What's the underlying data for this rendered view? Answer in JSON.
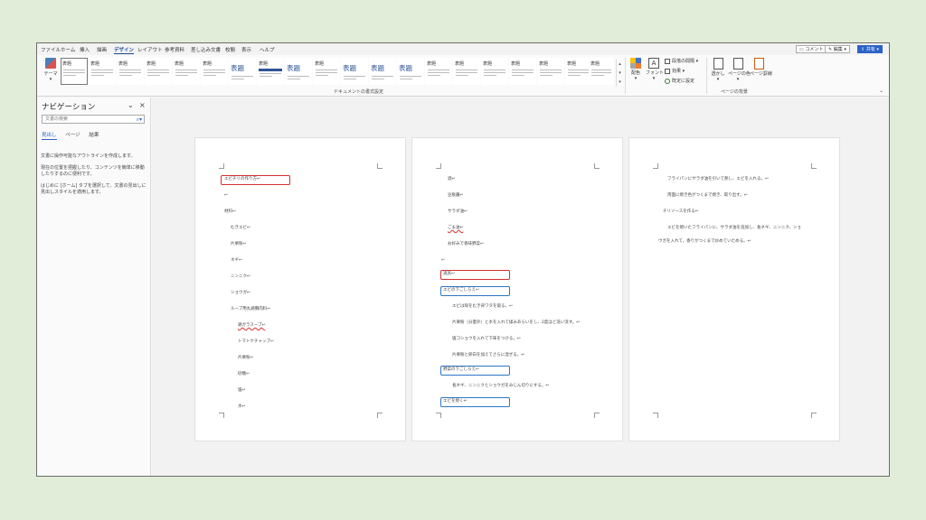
{
  "menu": {
    "tabs": [
      "ファイル",
      "ホーム",
      "挿入",
      "描画",
      "デザイン",
      "レイアウト",
      "参考資料",
      "差し込み文書",
      "校閲",
      "表示",
      "ヘルプ"
    ],
    "active_tab": "デザイン",
    "comment_label": "コメント",
    "edit_label": "編集",
    "share_label": "共有"
  },
  "ribbon": {
    "theme_label": "テーマ",
    "gallery_items": [
      "表題",
      "表題",
      "表題",
      "表題",
      "表題",
      "表題",
      "表題",
      "表題",
      "表題",
      "表題",
      "表題",
      "表題",
      "表題",
      "表題",
      "表題",
      "表題",
      "表題",
      "表題",
      "表題",
      "表題"
    ],
    "document_format_group": "ドキュメントの書式設定",
    "colors_label": "配色",
    "fonts_label": "フォント",
    "paragraph_spacing_label": "段落の間隔",
    "effects_label": "効果",
    "set_default_label": "既定に設定",
    "watermark_label": "透かし",
    "page_color_label": "ページの色",
    "page_border_label": "ページ罫線",
    "page_background_group": "ページの背景"
  },
  "nav": {
    "title": "ナビゲーション",
    "search_placeholder": "文書の検索",
    "tabs": [
      "見出し",
      "ページ",
      "結果"
    ],
    "active_tab": "見出し",
    "help1": "文書に操作可能なアウトラインを作成します。",
    "help2": "現在の位置を把握したり、コンテンツを簡単に移動したりするのに便利です。",
    "help3": "はじめに [ホーム] タブを選択して、文書の見出しに見出しスタイルを適用します。"
  },
  "page1": {
    "lines": [
      "エビチリの作り方↩",
      "↩",
      "材料↩",
      "むきエビ↩",
      "片栗粉↩",
      "ネギ↩",
      "ニンニク↩",
      "ショウガ↩",
      "ループ用丸鶏胸肉料↩",
      "鶏ガラスープ↩",
      "トマトケチャップ↩",
      "片栗粉↩",
      "砂糖↩",
      "塩↩",
      "水↩"
    ]
  },
  "page2": {
    "lines": [
      "酒↩",
      "豆板醤↩",
      "サラダ油↩",
      "ごま油↩",
      "お好みで香味野菜↩",
      "↩",
      "道具↩",
      "エビの下ごしらえ↩",
      "エビは殻をむき背ワタを取る。↩",
      "片栗粉（分量外）と水を入れて揉みあらいをし、2度ほど洗い流す。↩",
      "塩コショウを入れて下味をつける。↩",
      "片栗粉と卵白を加えてさらに混ぜる。↩",
      "野菜の下ごしらえ↩",
      "長ネギ、ニンニクとショウガをみじん切りにする。↩",
      "エビを焼く↩"
    ]
  },
  "page3": {
    "lines": [
      "フライパンにサラダ油を引いて熱し、エビを入れる。↩",
      "両面に焼き色がつくまで焼き、取り出す。↩",
      "チリソースを作る↩",
      "エビを焼いたフライパンに、サラダ油を追加し、長ネギ、ニンニク、ショ",
      "ウガを入れて、香りがつくまで炒めていためる。↩"
    ]
  }
}
